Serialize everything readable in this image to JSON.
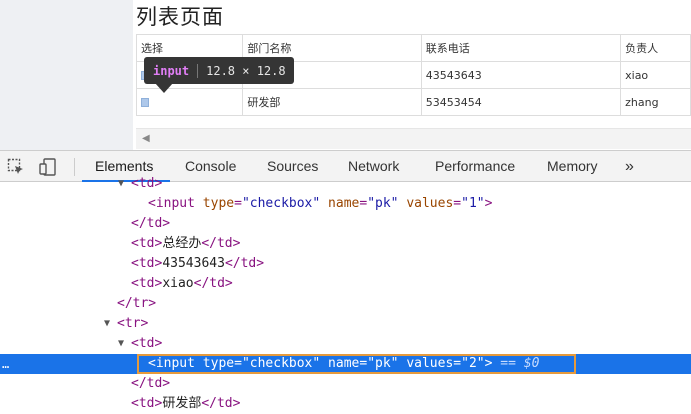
{
  "page": {
    "title": "列表页面",
    "table": {
      "headers": [
        "选择",
        "部门名称",
        "联系电话",
        "负责人"
      ],
      "rows": [
        {
          "dept": "",
          "phone": "43543643",
          "owner": "xiao"
        },
        {
          "dept": "研发部",
          "phone": "53453454",
          "owner": "zhang"
        }
      ]
    }
  },
  "tooltip": {
    "tag": "input",
    "size": "12.8 × 12.8"
  },
  "devtools": {
    "tabs": [
      "Elements",
      "Console",
      "Sources",
      "Network",
      "Performance",
      "Memory"
    ],
    "more": "»",
    "code": {
      "l0_tag": "<td>",
      "l1_input": "<input",
      "attr_type": "type",
      "val_checkbox": "\"checkbox\"",
      "attr_name": "name",
      "val_pk": "\"pk\"",
      "attr_values": "values",
      "val_1": "\"1\"",
      "close": ">",
      "td_close": "</td>",
      "td_open": "<td>",
      "text_zongjingban": "总经办",
      "text_phone": "43543643",
      "text_xiao": "xiao",
      "tr_close": "</tr>",
      "tr_open": "<tr>",
      "val_2": "\"2\"",
      "eq_dollar": " == $0",
      "text_yanfabu": "研发部",
      "dots": "…"
    }
  }
}
